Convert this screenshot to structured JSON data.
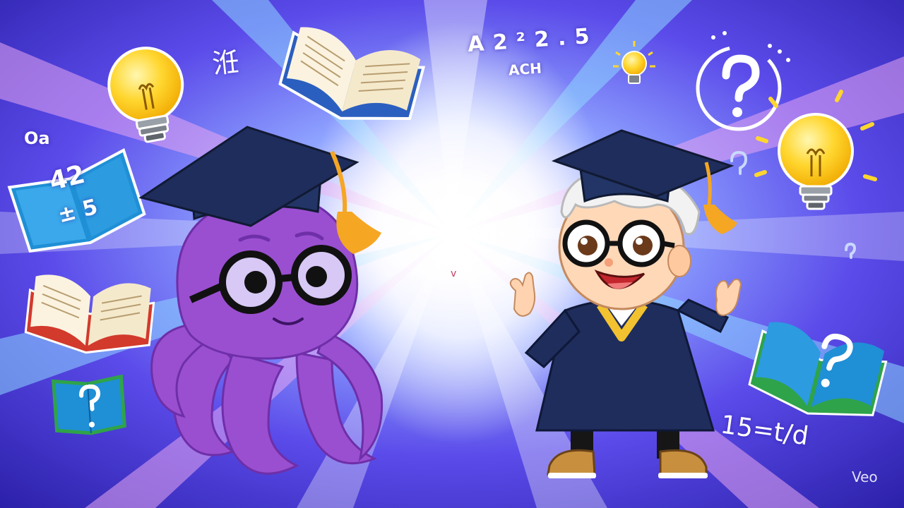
{
  "scene": {
    "description_free": true,
    "palette": {
      "background_deep": "#2a1fa8",
      "background_mid": "#5b4bea",
      "burst_center": "#ffffff",
      "ray_pink": "#e7a6f0",
      "ray_cyan": "#8fd8ff",
      "octopus_purple": "#9a4fd0",
      "octopus_dark": "#6e2fa8",
      "cap_navy": "#1f2d5c",
      "tassel_orange": "#f5a623",
      "gown_navy": "#1f2d5c",
      "gown_trim_gold": "#f2c230",
      "bulb_yellow": "#ffd62e",
      "book_blue": "#1f8fd6"
    },
    "icons": [
      "lightbulb-icon",
      "open-book-icon",
      "question-mark-icon",
      "graduation-cap-icon",
      "glasses-icon"
    ]
  },
  "scribbles": {
    "top_center": "A 2 ² 2 . 5",
    "top_center_sub": "ACH",
    "top_left_glyph": "㳝",
    "left_oa": "Oa",
    "left_book": "42",
    "left_book_sub": "± 5",
    "bottom_right": "15=t/d"
  },
  "watermark": "Veo",
  "center_mark": "v"
}
